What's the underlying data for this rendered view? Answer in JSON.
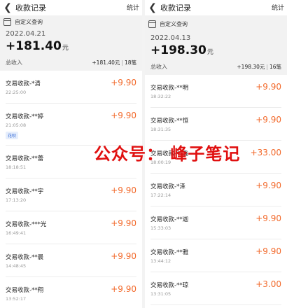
{
  "left": {
    "header": {
      "title": "收款记录",
      "stats_label": "统计"
    },
    "custom_query": "自定义查询",
    "summary": {
      "date": "2022.04.21",
      "amount": "+181.40",
      "unit": "元",
      "total_label": "总收入",
      "total_amount": "+181.40元",
      "count": "18笔"
    },
    "transactions": [
      {
        "name": "交易收款-*清",
        "time": "22:25:00",
        "amount": "+9.90"
      },
      {
        "name": "交易收款-**婷",
        "time": "21:05:08",
        "amount": "+9.90",
        "tag": "花呗"
      },
      {
        "name": "交易收款-**蕾",
        "time": "18:18:51",
        "amount": ""
      },
      {
        "name": "交易收款-**宇",
        "time": "17:13:20",
        "amount": "+9.90"
      },
      {
        "name": "交易收款-***光",
        "time": "16:49:41",
        "amount": "+9.90"
      },
      {
        "name": "交易收款-**晨",
        "time": "14:48:45",
        "amount": "+9.90"
      },
      {
        "name": "交易收款-**翔",
        "time": "13:52:17",
        "amount": "+9.90"
      }
    ]
  },
  "right": {
    "header": {
      "title": "收款记录",
      "stats_label": "统计"
    },
    "custom_query": "自定义查询",
    "summary": {
      "date": "2022.04.13",
      "amount": "+198.30",
      "unit": "元",
      "total_label": "总收入",
      "total_amount": "+198.30元",
      "count": "16笔"
    },
    "transactions": [
      {
        "name": "交易收款-**明",
        "time": "18:32:22",
        "amount": "+9.90"
      },
      {
        "name": "交易收款-**恒",
        "time": "18:31:35",
        "amount": "+9.90"
      },
      {
        "name": "交易收款-**鑫",
        "time": "18:00:19",
        "amount": "+33.00"
      },
      {
        "name": "交易收款-*泽",
        "time": "17:22:14",
        "amount": "+9.90"
      },
      {
        "name": "交易收款-**迦",
        "time": "15:33:03",
        "amount": "+9.90"
      },
      {
        "name": "交易收款-**雅",
        "time": "13:44:12",
        "amount": "+9.90"
      },
      {
        "name": "交易收款-**琼",
        "time": "13:31:05",
        "amount": "+3.00"
      }
    ]
  },
  "watermark": "公众号：  峰子笔记",
  "colors": {
    "accent_amount": "#f26a2c",
    "watermark": "#e01010",
    "tag": "#3a6fd8"
  }
}
